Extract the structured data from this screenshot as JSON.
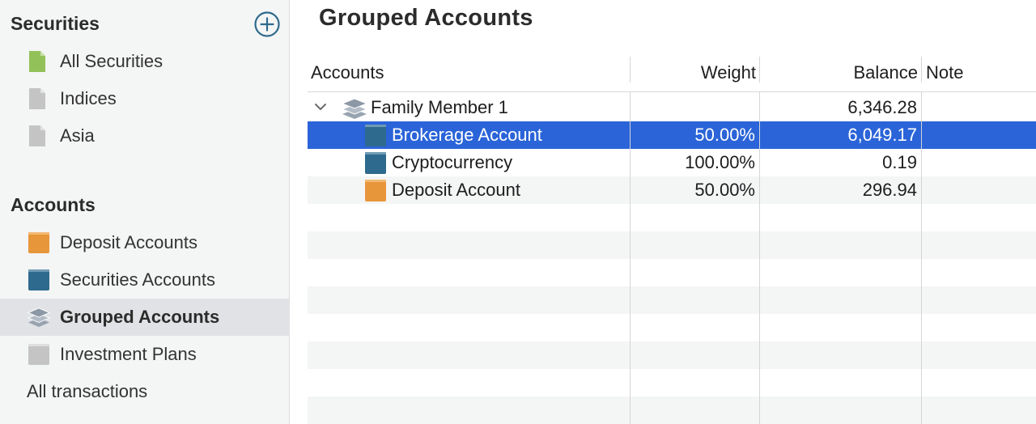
{
  "sidebar": {
    "securities_header": "Securities",
    "securities_items": [
      {
        "label": "All Securities",
        "icon": "green-document-icon"
      },
      {
        "label": "Indices",
        "icon": "gray-document-icon"
      },
      {
        "label": "Asia",
        "icon": "gray-document-icon"
      }
    ],
    "accounts_header": "Accounts",
    "accounts_items": [
      {
        "label": "Deposit Accounts",
        "icon": "orange-book-icon"
      },
      {
        "label": "Securities Accounts",
        "icon": "blue-book-icon"
      },
      {
        "label": "Grouped Accounts",
        "icon": "stack-layers-icon",
        "selected": true
      },
      {
        "label": "Investment Plans",
        "icon": "gray-book-icon"
      }
    ],
    "all_transactions": "All transactions"
  },
  "main": {
    "title": "Grouped Accounts",
    "columns": {
      "accounts": "Accounts",
      "weight": "Weight",
      "balance": "Balance",
      "note": "Note"
    },
    "rows": [
      {
        "name": "Family Member 1",
        "weight": "",
        "balance": "6,346.28",
        "note": "",
        "type": "group",
        "icon": "stack-layers-icon",
        "expanded": true
      },
      {
        "name": "Brokerage Account",
        "weight": "50.00%",
        "balance": "6,049.17",
        "note": "",
        "type": "account",
        "icon": "blue-book-icon",
        "selected": true
      },
      {
        "name": "Cryptocurrency",
        "weight": "100.00%",
        "balance": "0.19",
        "note": "",
        "type": "account",
        "icon": "blue-book-icon"
      },
      {
        "name": "Deposit Account",
        "weight": "50.00%",
        "balance": "296.94",
        "note": "",
        "type": "account",
        "icon": "orange-book-icon"
      }
    ]
  },
  "colors": {
    "selection": "#2a64d8",
    "sidebar_bg": "#f4f5f5",
    "orange_book": "#e8963a",
    "blue_book": "#2e6a8d",
    "gray_doc": "#c4c4c4",
    "green_doc": "#93c159"
  }
}
